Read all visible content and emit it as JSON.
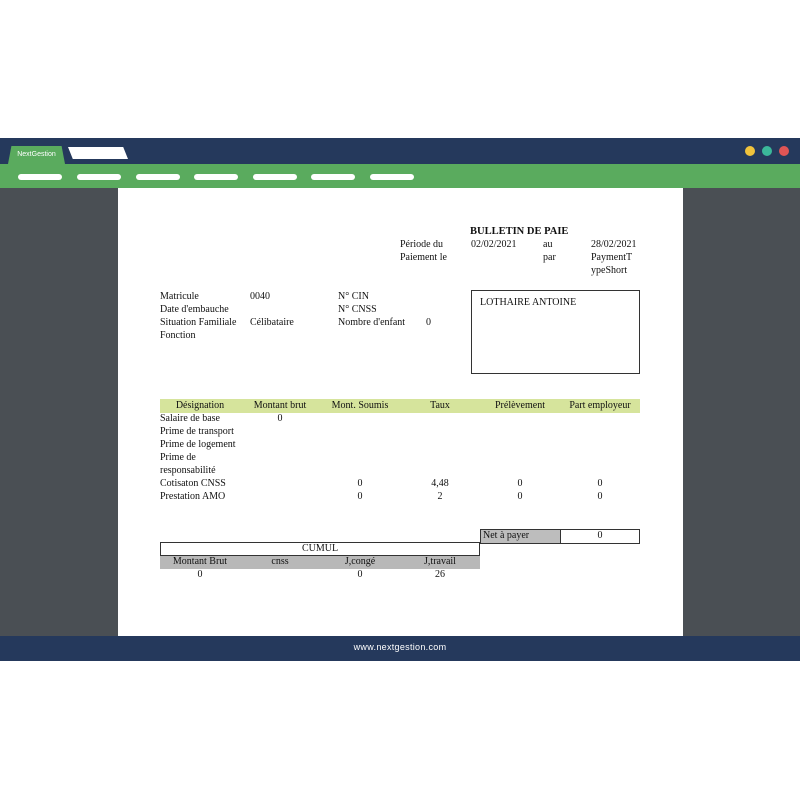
{
  "browser": {
    "tab_label": "NextGestion",
    "footer_url": "www.nextgestion.com",
    "dot_colors": [
      "#f0c33c",
      "#3bb89a",
      "#e05555"
    ]
  },
  "payslip": {
    "title": "BULLETIN DE PAIE",
    "periode_label": "Période du",
    "periode_start": "02/02/2021",
    "au_label": "au",
    "periode_end": "28/02/2021",
    "paiement_label": "Paiement le",
    "par_label": "par",
    "payment_type_line1": "PaymentT",
    "payment_type_line2": "ypeShort",
    "employee_name": "LOTHAIRE ANTOINE",
    "info": {
      "matricule_label": "Matricule",
      "matricule_value": "0040",
      "embauche_label": "Date d'embauche",
      "situation_label": "Situation Familiale",
      "situation_value": "Célibataire",
      "fonction_label": "Fonction",
      "cin_label": "N° CIN",
      "cnss_label": "N° CNSS",
      "enfant_label": "Nombre d'enfant",
      "enfant_value": "0"
    },
    "columns": [
      "Désignation",
      "Montant brut",
      "Mont. Soumis",
      "Taux",
      "Prélèvement",
      "Part employeur"
    ],
    "rows": [
      {
        "designation": "Salaire de base",
        "brut": "0",
        "soumis": "",
        "taux": "",
        "prelevement": "",
        "employeur": ""
      },
      {
        "designation": "Prime de transport",
        "brut": "",
        "soumis": "",
        "taux": "",
        "prelevement": "",
        "employeur": ""
      },
      {
        "designation": "Prime de logement",
        "brut": "",
        "soumis": "",
        "taux": "",
        "prelevement": "",
        "employeur": ""
      },
      {
        "designation": "Prime de",
        "brut": "",
        "soumis": "",
        "taux": "",
        "prelevement": "",
        "employeur": ""
      },
      {
        "designation": "responsabilité",
        "brut": "",
        "soumis": "",
        "taux": "",
        "prelevement": "",
        "employeur": ""
      },
      {
        "designation": "Cotisaton CNSS",
        "brut": "",
        "soumis": "0",
        "taux": "4,48",
        "prelevement": "0",
        "employeur": "0"
      },
      {
        "designation": "Prestation AMO",
        "brut": "",
        "soumis": "0",
        "taux": "2",
        "prelevement": "0",
        "employeur": "0"
      }
    ],
    "net_label": "Net à payer",
    "net_value": "0",
    "cumul_label": "CUMUL",
    "cumul_columns": [
      "Montant Brut",
      "cnss",
      "J,congé",
      "J,travail"
    ],
    "cumul_values": [
      "0",
      "",
      "0",
      "26"
    ]
  }
}
